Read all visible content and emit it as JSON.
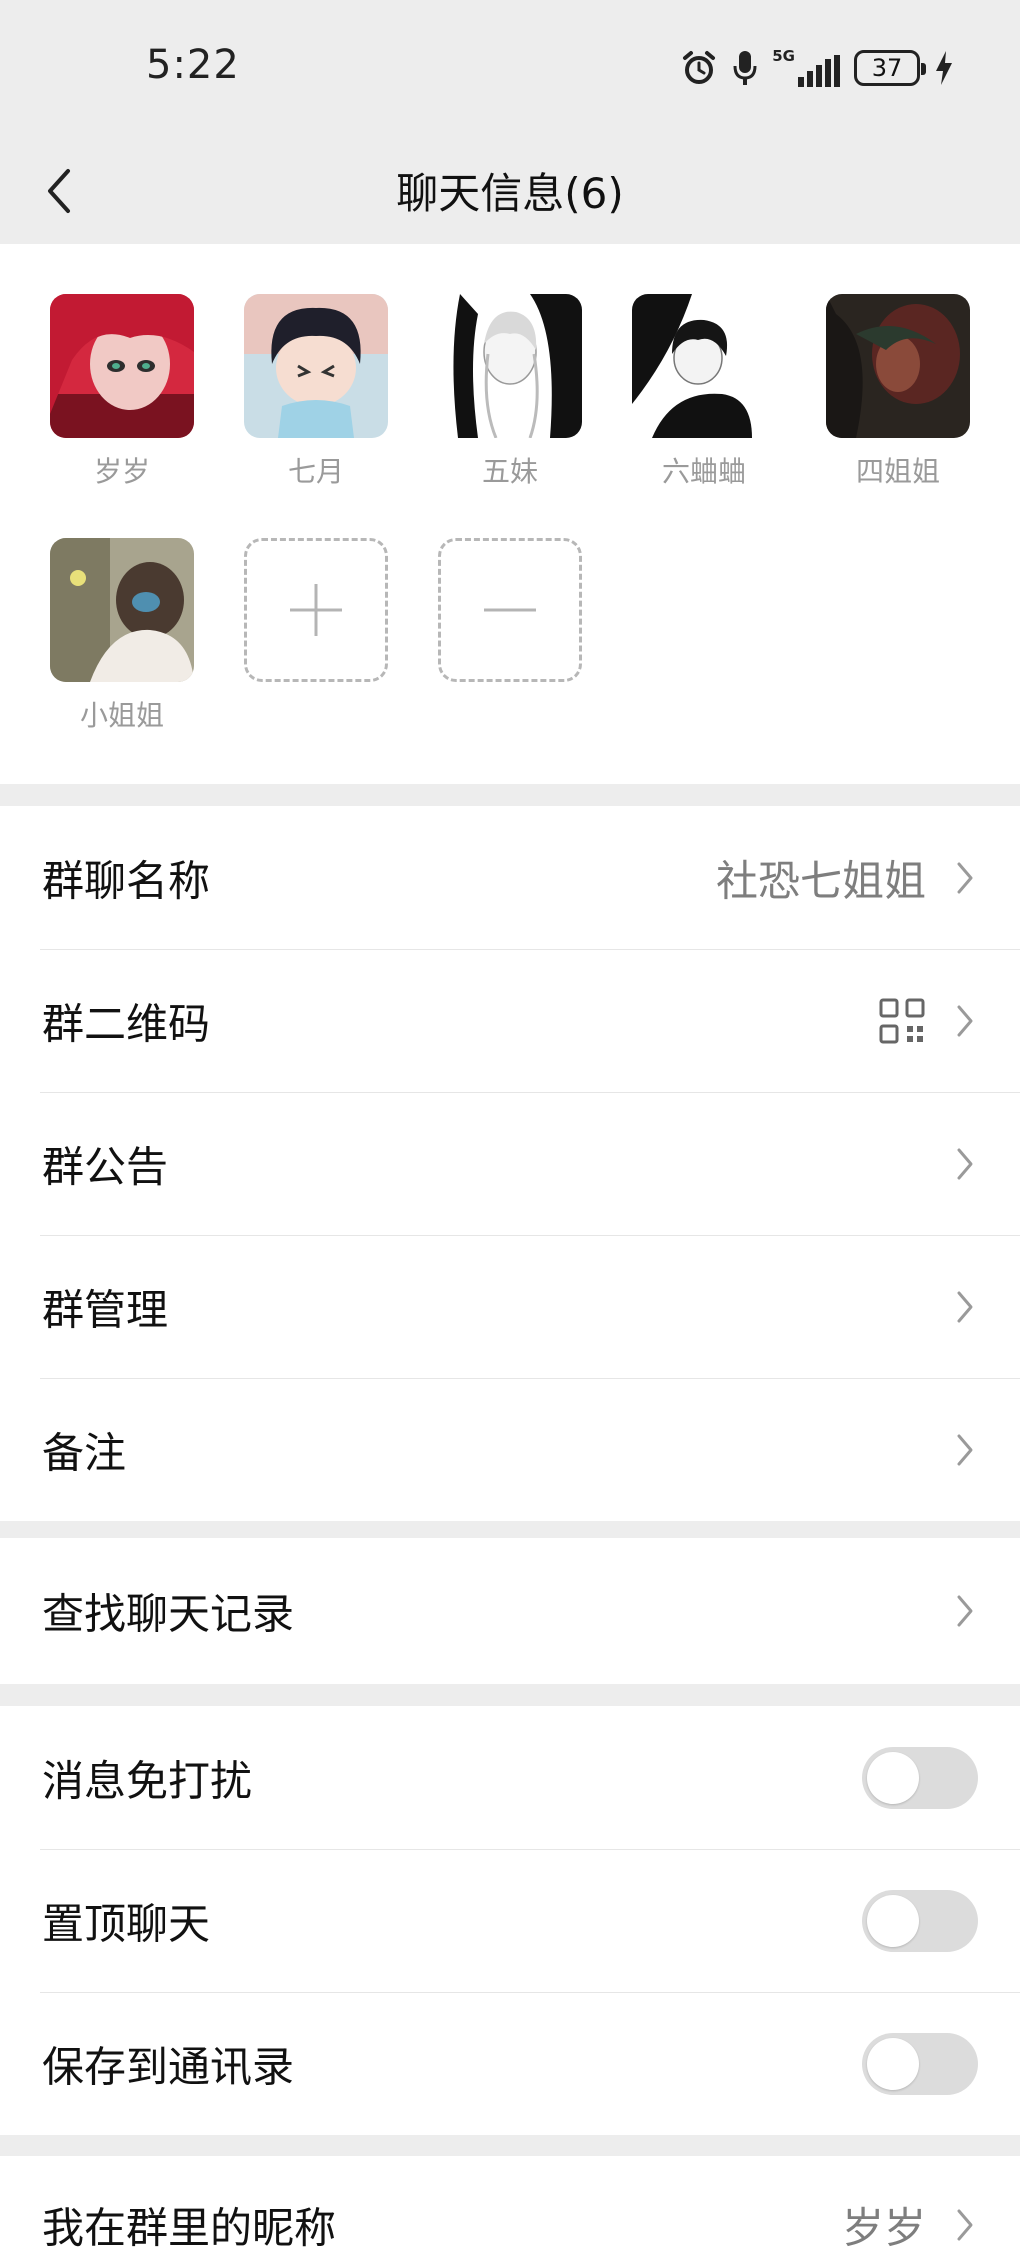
{
  "status": {
    "time": "5:22",
    "network": "5G",
    "battery": "37"
  },
  "nav": {
    "title": "聊天信息(6)"
  },
  "members": [
    {
      "name": "岁岁"
    },
    {
      "name": "七月"
    },
    {
      "name": "五妹"
    },
    {
      "name": "六蛐蛐"
    },
    {
      "name": "四姐姐"
    },
    {
      "name": "小姐姐"
    }
  ],
  "settings": {
    "group_name": {
      "label": "群聊名称",
      "value": "社恐七姐姐"
    },
    "qr_code": {
      "label": "群二维码"
    },
    "announcement": {
      "label": "群公告"
    },
    "management": {
      "label": "群管理"
    },
    "remark": {
      "label": "备注"
    },
    "search_history": {
      "label": "查找聊天记录"
    },
    "mute": {
      "label": "消息免打扰",
      "on": false
    },
    "pin": {
      "label": "置顶聊天",
      "on": false
    },
    "save_contacts": {
      "label": "保存到通讯录",
      "on": false
    },
    "my_nickname": {
      "label": "我在群里的昵称",
      "value": "岁岁"
    }
  }
}
